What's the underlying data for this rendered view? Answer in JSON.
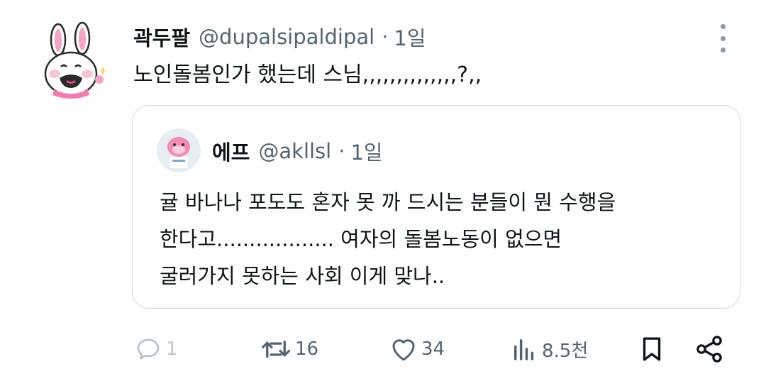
{
  "tweet": {
    "display_name": "곽두팔",
    "handle": "@dupalsipaldipal",
    "dot": "·",
    "time": "1일",
    "text": "노인돌봄인가 했는데 스님,,,,,,,,,,,,,,?,,"
  },
  "quoted": {
    "display_name": "에프",
    "handle": "@akllsl",
    "dot": "·",
    "time": "1일",
    "lines": [
      "귤 바나나 포도도 혼자 못 까 드시는 분들이 뭔 수행을",
      "한다고.................. 여자의 돌봄노동이 없으면",
      "굴러가지 못하는 사회 이게 맞나.."
    ]
  },
  "actions": {
    "reply_count": "1",
    "retweet_count": "16",
    "like_count": "34",
    "views_count": "8.5천"
  },
  "icons": {
    "more": "more-vertical-icon",
    "reply": "reply-icon",
    "retweet": "retweet-icon",
    "like": "heart-icon",
    "views": "views-icon",
    "bookmark": "bookmark-icon",
    "share": "share-icon"
  },
  "colors": {
    "text": "#0f1419",
    "muted": "#536471",
    "border": "#cfd9de",
    "reply_disabled": "#b9c3cb"
  }
}
